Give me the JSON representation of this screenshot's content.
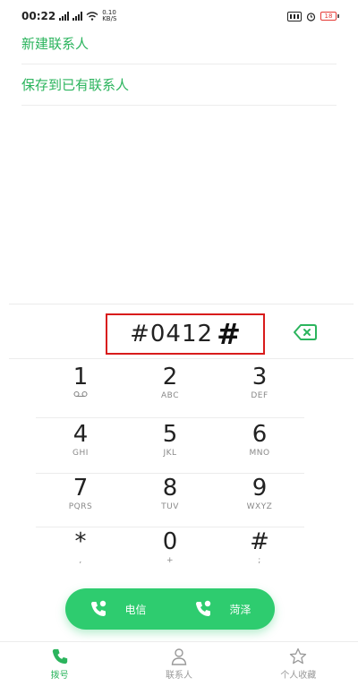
{
  "status": {
    "time": "00:22",
    "net_speed_value": "0.10",
    "net_speed_unit": "KB/S",
    "battery": "18"
  },
  "menu": {
    "new_contact": "新建联系人",
    "save_to_existing": "保存到已有联系人"
  },
  "dialer": {
    "number": "#0412",
    "cursor_hash": "#"
  },
  "keypad": [
    {
      "digit": "1",
      "letters": ""
    },
    {
      "digit": "2",
      "letters": "ABC"
    },
    {
      "digit": "3",
      "letters": "DEF"
    },
    {
      "digit": "4",
      "letters": "GHI"
    },
    {
      "digit": "5",
      "letters": "JKL"
    },
    {
      "digit": "6",
      "letters": "MNO"
    },
    {
      "digit": "7",
      "letters": "PQRS"
    },
    {
      "digit": "8",
      "letters": "TUV"
    },
    {
      "digit": "9",
      "letters": "WXYZ"
    },
    {
      "digit": "*",
      "letters": ","
    },
    {
      "digit": "0",
      "letters": "+"
    },
    {
      "digit": "#",
      "letters": ";"
    }
  ],
  "call_buttons": {
    "sim1": "电信",
    "sim2": "菏泽"
  },
  "bottom_nav": {
    "dial": "拨号",
    "contacts": "联系人",
    "favorites": "个人收藏"
  },
  "colors": {
    "accent": "#2bb45d",
    "call_button": "#2ecc6f",
    "highlight_box": "#d81b1b"
  }
}
